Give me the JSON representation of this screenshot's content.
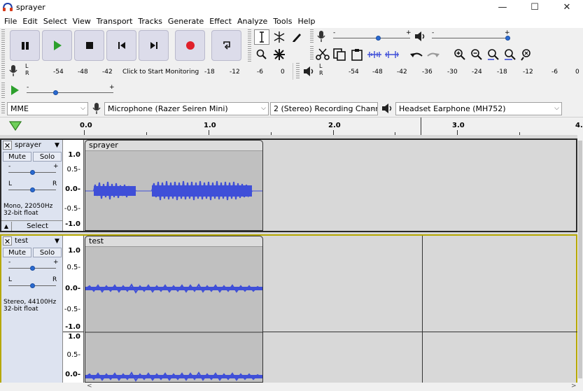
{
  "window": {
    "title": "sprayer",
    "minimize": "—",
    "maximize": "☐",
    "close": "✕"
  },
  "menu": [
    "File",
    "Edit",
    "Select",
    "View",
    "Transport",
    "Tracks",
    "Generate",
    "Effect",
    "Analyze",
    "Tools",
    "Help"
  ],
  "transport": {
    "pause": "pause-icon",
    "play": "play-icon",
    "stop": "stop-icon",
    "skip_start": "skip-start-icon",
    "skip_end": "skip-end-icon",
    "record": "record-icon",
    "loop": "loop-icon"
  },
  "colors": {
    "record": "#e0202a",
    "play": "#2ca02c",
    "waveform": "#3f4fd8",
    "clip_bg": "#c0c0c0",
    "track_panel": "#dde3f0",
    "selected_track_border": "#b6a800"
  },
  "recording_meter": {
    "scale": [
      "-54",
      "-48",
      "-42",
      "-18",
      "-12",
      "-6",
      "0"
    ],
    "prompt": "Click to Start Monitoring"
  },
  "playback_meter": {
    "scale": [
      "-54",
      "-48",
      "-42",
      "-36",
      "-30",
      "-24",
      "-18",
      "-12",
      "-6",
      "0"
    ]
  },
  "meter_lr": {
    "left": "L",
    "right": "R"
  },
  "slider_marks": {
    "minus": "-",
    "plus": "+"
  },
  "device": {
    "host": "MME",
    "input": "Microphone (Razer Seiren Mini)",
    "channels": "2 (Stereo) Recording Chann",
    "output": "Headset Earphone (MH752)"
  },
  "timeline": {
    "labels": [
      "0.0",
      "1.0",
      "2.0",
      "3.0",
      "4.0"
    ],
    "last_visible": "4."
  },
  "tracks": [
    {
      "name": "sprayer",
      "mute": "Mute",
      "solo": "Solo",
      "pan_left": "L",
      "pan_right": "R",
      "info_line1": "Mono, 22050Hz",
      "info_line2": "32-bit float",
      "select": "Select",
      "clip_name": "sprayer",
      "scale": [
        "1.0",
        "0.5-",
        "0.0-",
        "-0.5-",
        "-1.0"
      ]
    },
    {
      "name": "test",
      "mute": "Mute",
      "solo": "Solo",
      "pan_left": "L",
      "pan_right": "R",
      "info_line1": "Stereo, 44100Hz",
      "info_line2": "32-bit float",
      "clip_name": "test",
      "scale": [
        "1.0",
        "0.5-",
        "0.0-",
        "-0.5-",
        "-1.0",
        "1.0",
        "0.5-",
        "0.0-"
      ]
    }
  ]
}
